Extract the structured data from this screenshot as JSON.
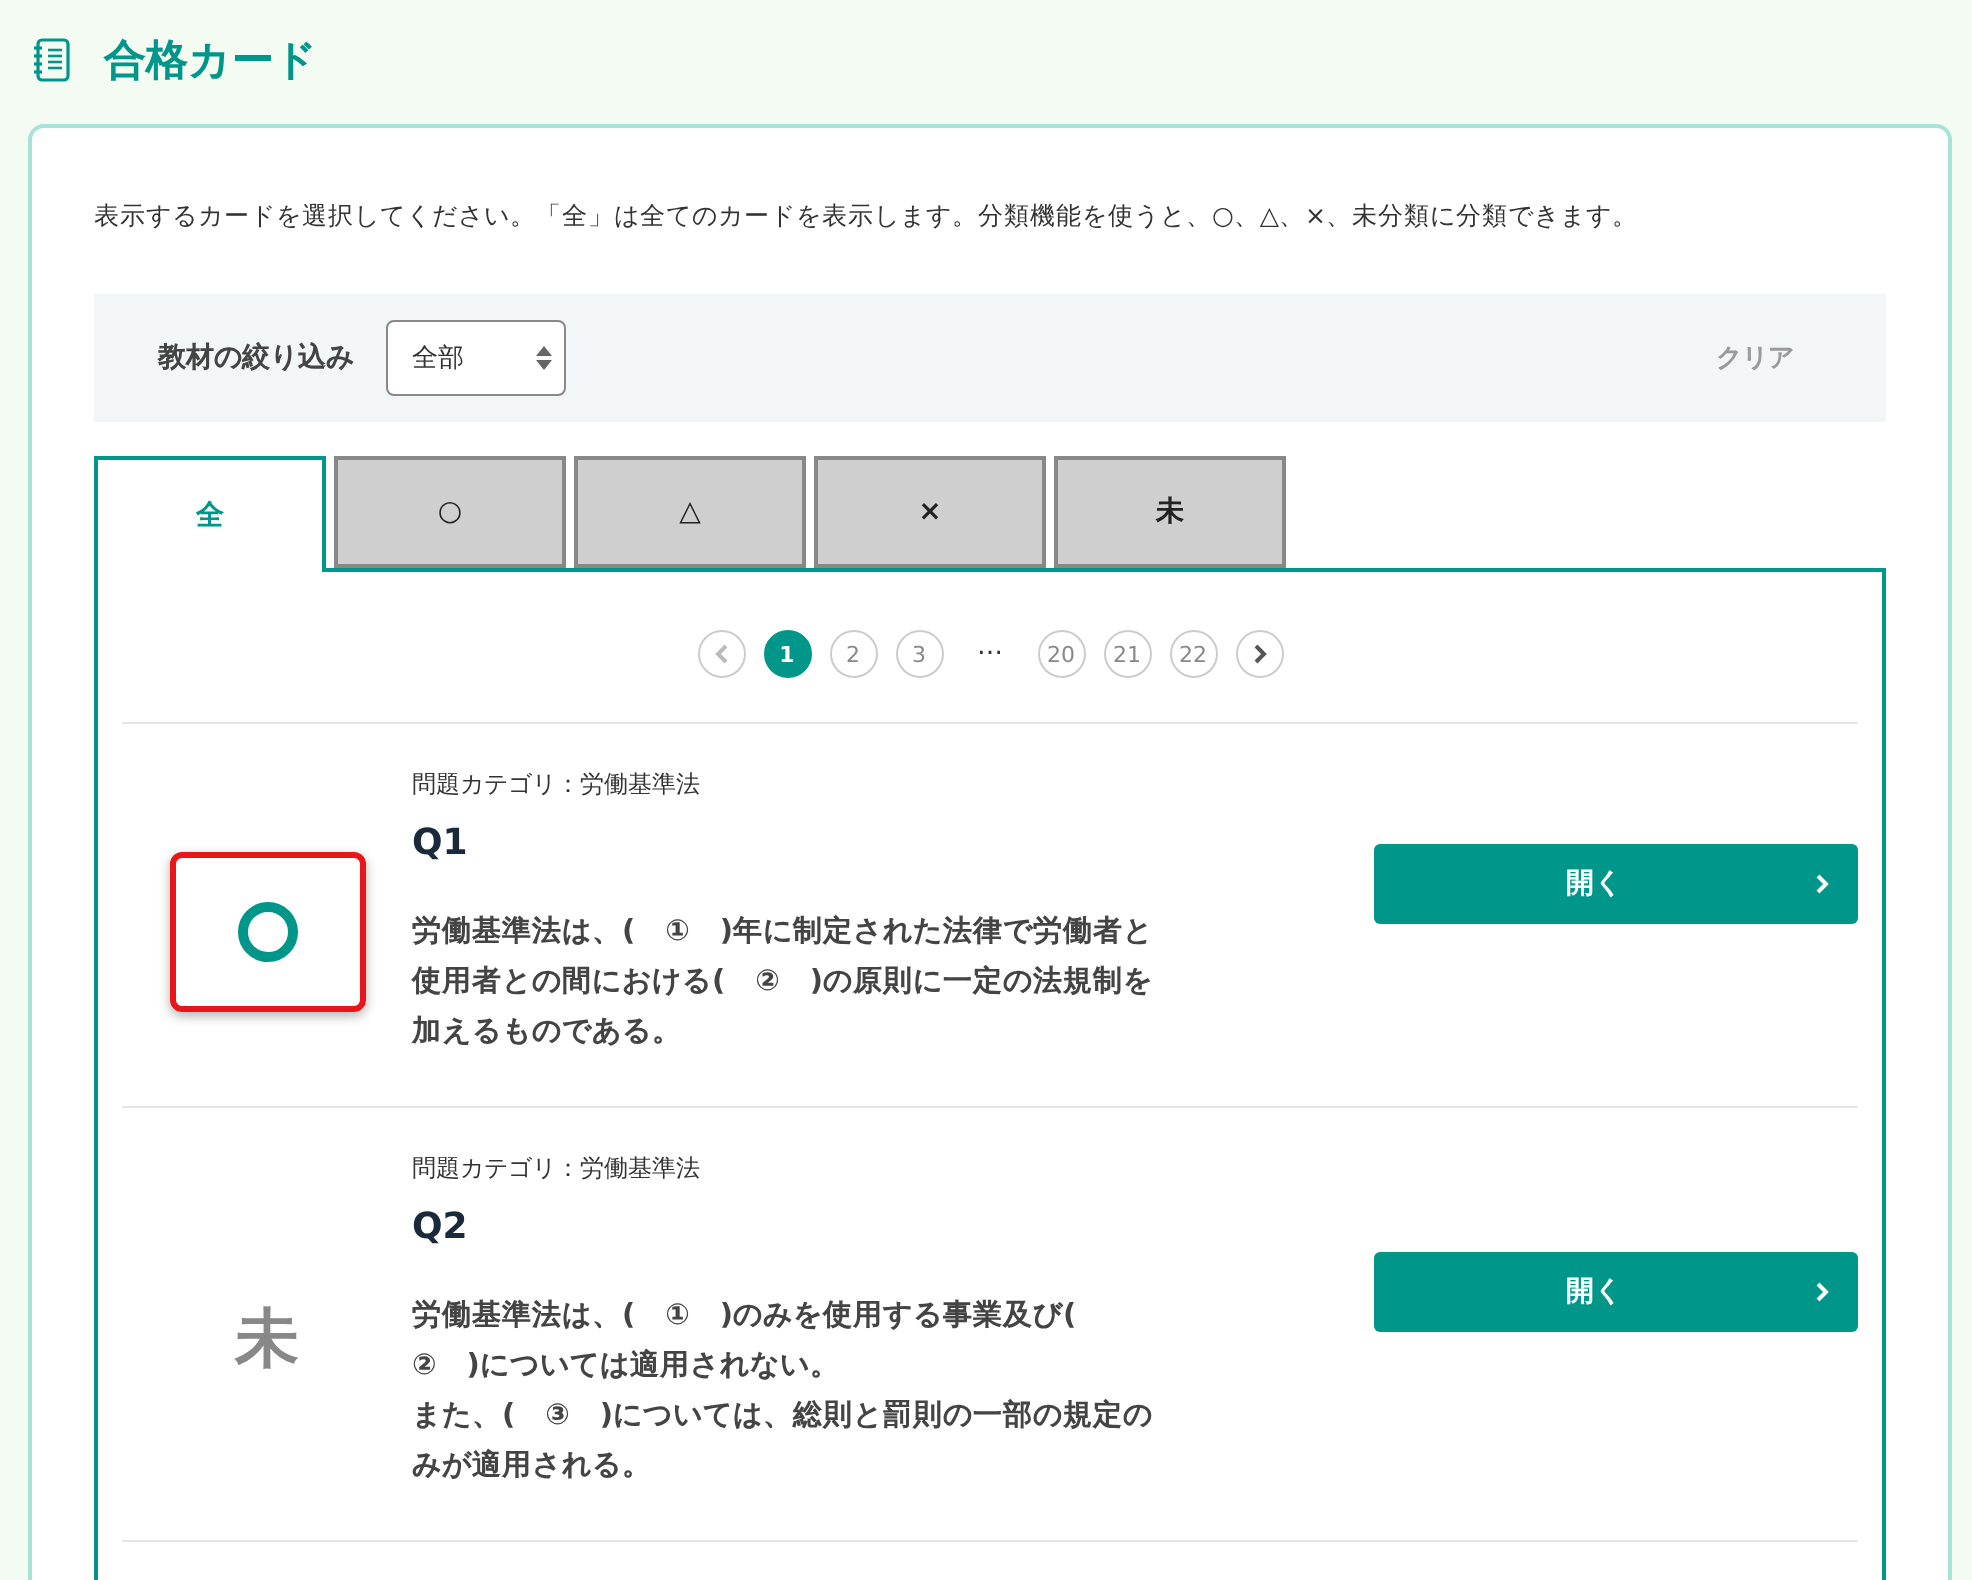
{
  "page_title": "合格カード",
  "description": "表示するカードを選択してください。「全」は全てのカードを表示します。分類機能を使うと、○、△、×、未分類に分類できます。",
  "filter": {
    "label": "教材の絞り込み",
    "value": "全部",
    "clear": "クリア",
    "clear_disabled": true
  },
  "tabs": [
    {
      "label": "全",
      "selected": true
    },
    {
      "label": "○",
      "selected": false
    },
    {
      "label": "△",
      "selected": false
    },
    {
      "label": "×",
      "selected": false
    },
    {
      "label": "未",
      "selected": false
    }
  ],
  "pagination": {
    "items": [
      {
        "kind": "page",
        "label": "1",
        "selected": true
      },
      {
        "kind": "page",
        "label": "2",
        "selected": false
      },
      {
        "kind": "page",
        "label": "3",
        "selected": false
      },
      {
        "kind": "ellipsis",
        "label": "…"
      },
      {
        "kind": "page",
        "label": "20",
        "selected": false
      },
      {
        "kind": "page",
        "label": "21",
        "selected": false
      },
      {
        "kind": "page",
        "label": "22",
        "selected": false
      }
    ],
    "prev_disabled": true,
    "next_disabled": false
  },
  "cards": [
    {
      "category": "問題カテゴリ：労働基準法",
      "title": "Q1",
      "status": {
        "kind": "circle"
      },
      "highlighted": true,
      "question_lines": [
        "労働基準法は、(　①　)年に制定された法律で労働者と",
        "使用者との間における(　②　)の原則に一定の法規制を",
        "加えるものである。"
      ],
      "button": "開く"
    },
    {
      "category": "問題カテゴリ：労働基準法",
      "title": "Q2",
      "status": {
        "kind": "text",
        "label": "未"
      },
      "highlighted": false,
      "question_lines": [
        "労働基準法は、(　①　)のみを使用する事業及び(",
        "②　)については適用されない。",
        "また、(　③　)については、総則と罰則の一部の規定の",
        "みが適用される。"
      ],
      "button": "開く"
    }
  ]
}
